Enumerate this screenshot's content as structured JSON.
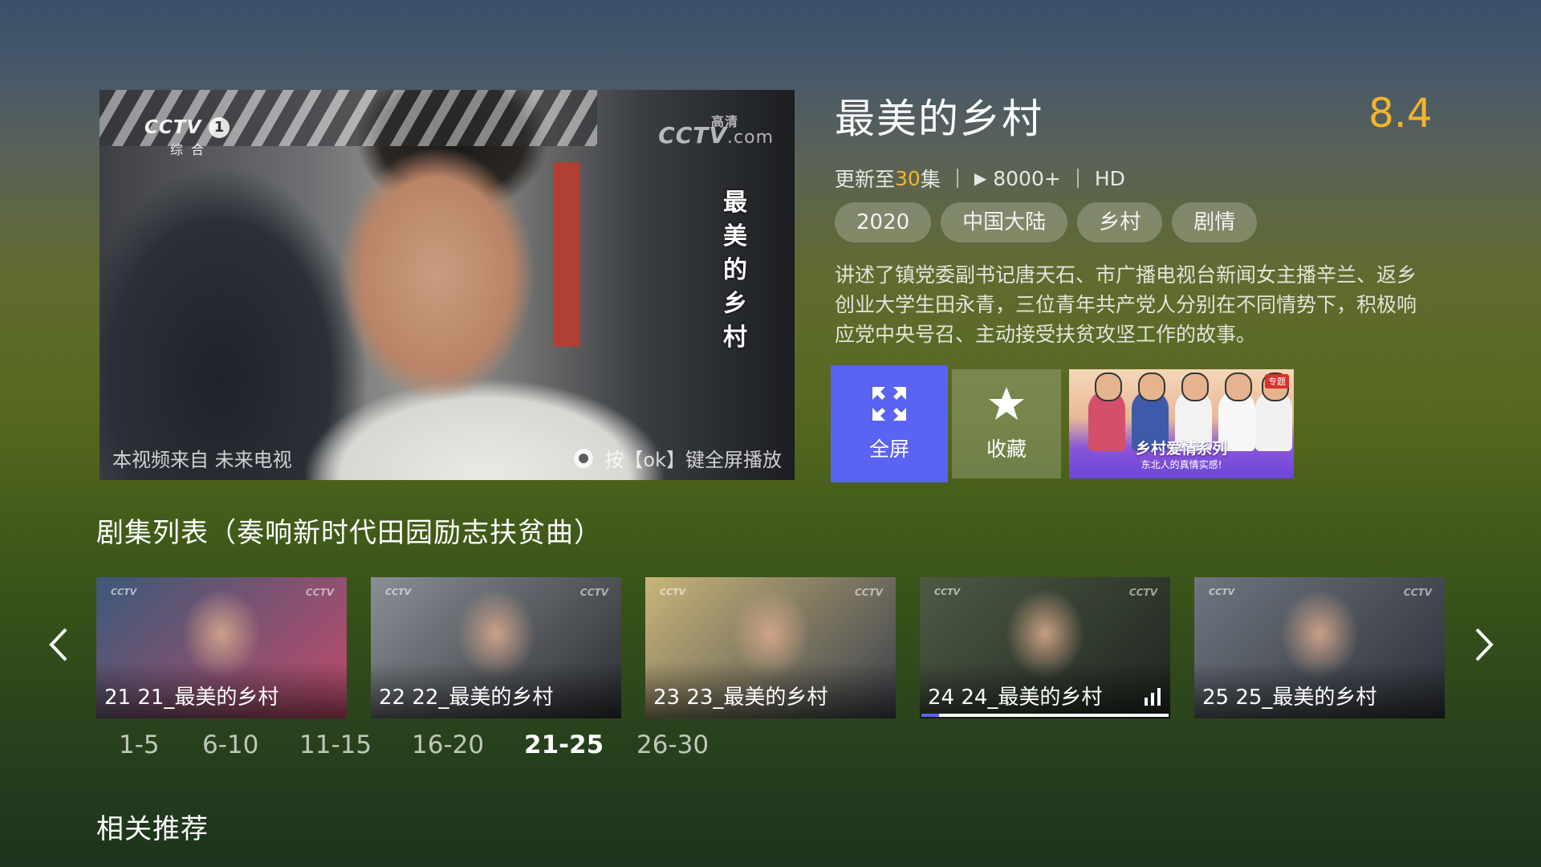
{
  "player": {
    "channel_logo": "CCTV",
    "channel_number": "1",
    "channel_sub": "综合",
    "watermark_main": "CCTV",
    "watermark_hd": "高清",
    "watermark_com": ".com",
    "vertical_title": "最美的乡村",
    "source_note": "本视频来自 未来电视",
    "ok_hint": "按【ok】键全屏播放"
  },
  "show": {
    "title": "最美的乡村",
    "rating": "8.4",
    "update_prefix": "更新至",
    "update_count": "30",
    "update_suffix": "集",
    "play_count": "8000+",
    "quality": "HD",
    "tags": [
      "2020",
      "中国大陆",
      "乡村",
      "剧情"
    ],
    "description": "讲述了镇党委副书记唐天石、市广播电视台新闻女主播辛兰、返乡创业大学生田永青，三位青年共产党人分别在不同情势下，积极响应党中央号召、主动接受扶贫攻坚工作的故事。"
  },
  "actions": {
    "fullscreen_label": "全屏",
    "favorite_label": "收藏",
    "promo_title": "乡村爱情系列",
    "promo_subtitle": "东北人的真情实感!",
    "promo_badge": "专题"
  },
  "episodes": {
    "section_title": "剧集列表（奏响新时代田园励志扶贫曲）",
    "items": [
      {
        "label": "21 21_最美的乡村",
        "color_a": "#3a5a78",
        "color_b": "#c24a6b"
      },
      {
        "label": "22 22_最美的乡村",
        "color_a": "#8a8f96",
        "color_b": "#2b2d31"
      },
      {
        "label": "23 23_最美的乡村",
        "color_a": "#c9b57a",
        "color_b": "#3a3f4a"
      },
      {
        "label": "24 24_最美的乡村",
        "color_a": "#4d5a43",
        "color_b": "#1e2420"
      },
      {
        "label": "25 25_最美的乡村",
        "color_a": "#6f7680",
        "color_b": "#2c2f36"
      }
    ],
    "active_index": 3,
    "ranges": [
      "1-5",
      "6-10",
      "11-15",
      "16-20",
      "21-25",
      "26-30"
    ],
    "selected_range": "21-25"
  },
  "recommend": {
    "title": "相关推荐"
  },
  "colors": {
    "accent": "#5a63f2",
    "rating": "#f3b42c"
  }
}
